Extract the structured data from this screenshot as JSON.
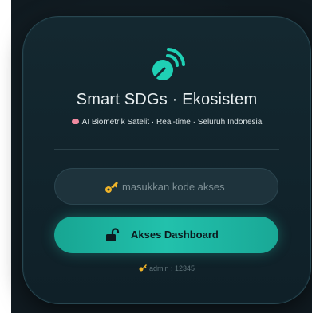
{
  "card": {
    "title": "Smart SDGs · Ekosistem",
    "subtitle": "AI Biometrik Satelit · Real-time · Seluruh Indonesia"
  },
  "login": {
    "placeholder": "masukkan kode akses",
    "button_label": "Akses Dashboard",
    "hint": "admin : 12345"
  },
  "icons": {
    "logo": "satellite-dish-icon",
    "subtitle": "brain-icon",
    "input": "key-icon",
    "button": "unlock-icon",
    "hint": "key-icon"
  },
  "colors": {
    "accent": "#22c1ac",
    "card_background": "#142830",
    "page_background": "#101a20",
    "brain_icon": "#f08aa0",
    "key_icon": "#f0b429"
  }
}
